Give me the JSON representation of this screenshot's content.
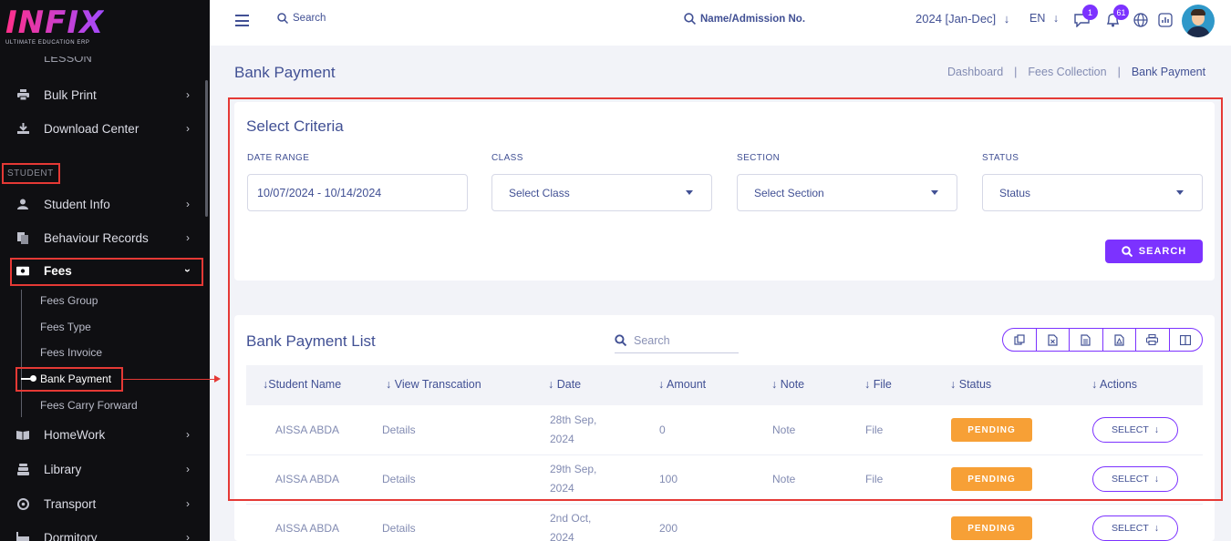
{
  "app": {
    "logo_text": "INFIX",
    "logo_subtitle": "ULTIMATE EDUCATION ERP"
  },
  "sidebar": {
    "items": [
      {
        "label": "Bulk Print",
        "icon": "printer-icon"
      },
      {
        "label": "Download Center",
        "icon": "download-icon"
      },
      {
        "label": "Student Info",
        "icon": "user-icon"
      },
      {
        "label": "Behaviour Records",
        "icon": "records-icon"
      },
      {
        "label": "Fees",
        "icon": "money-icon"
      },
      {
        "label": "HomeWork",
        "icon": "book-icon"
      },
      {
        "label": "Library",
        "icon": "library-icon"
      },
      {
        "label": "Transport",
        "icon": "transport-icon"
      },
      {
        "label": "Dormitory",
        "icon": "dormitory-icon"
      }
    ],
    "section_label": "STUDENT",
    "fees_sub": [
      "Fees Group",
      "Fees Type",
      "Fees Invoice",
      "Bank Payment",
      "Fees Carry Forward"
    ]
  },
  "topbar": {
    "search_label": "Search",
    "name_search_label": "Name/Admission No.",
    "session": "2024 [Jan-Dec]",
    "language": "EN",
    "message_count": "1",
    "notification_count": "61"
  },
  "page": {
    "title": "Bank Payment",
    "breadcrumb": [
      "Dashboard",
      "Fees Collection",
      "Bank Payment"
    ]
  },
  "criteria": {
    "title": "Select Criteria",
    "date_range_label": "DATE RANGE",
    "date_range_value": "10/07/2024 - 10/14/2024",
    "class_label": "CLASS",
    "class_value": "Select Class",
    "section_label": "SECTION",
    "section_value": "Select Section",
    "status_label": "STATUS",
    "status_value": "Status",
    "search_button": "SEARCH"
  },
  "list": {
    "title": "Bank Payment List",
    "search_placeholder": "Search",
    "columns": [
      "Student Name",
      "View Transcation",
      "Date",
      "Amount",
      "Note",
      "File",
      "Status",
      "Actions"
    ],
    "rows": [
      {
        "student": "AISSA ABDA",
        "view": "Details",
        "date_line1": "28th Sep,",
        "date_line2": "2024",
        "amount": "0",
        "note": "Note",
        "file": "File",
        "status": "PENDING",
        "action": "SELECT"
      },
      {
        "student": "AISSA ABDA",
        "view": "Details",
        "date_line1": "29th Sep,",
        "date_line2": "2024",
        "amount": "100",
        "note": "Note",
        "file": "File",
        "status": "PENDING",
        "action": "SELECT"
      },
      {
        "student": "AISSA ABDA",
        "view": "Details",
        "date_line1": "2nd Oct,",
        "date_line2": "2024",
        "amount": "200",
        "note": "",
        "file": "",
        "status": "PENDING",
        "action": "SELECT"
      }
    ]
  },
  "colors": {
    "accent": "#7c32ff",
    "text": "#415094",
    "pending": "#f7a036",
    "highlight": "#e53935",
    "sidebar_bg": "#0f0f12"
  }
}
